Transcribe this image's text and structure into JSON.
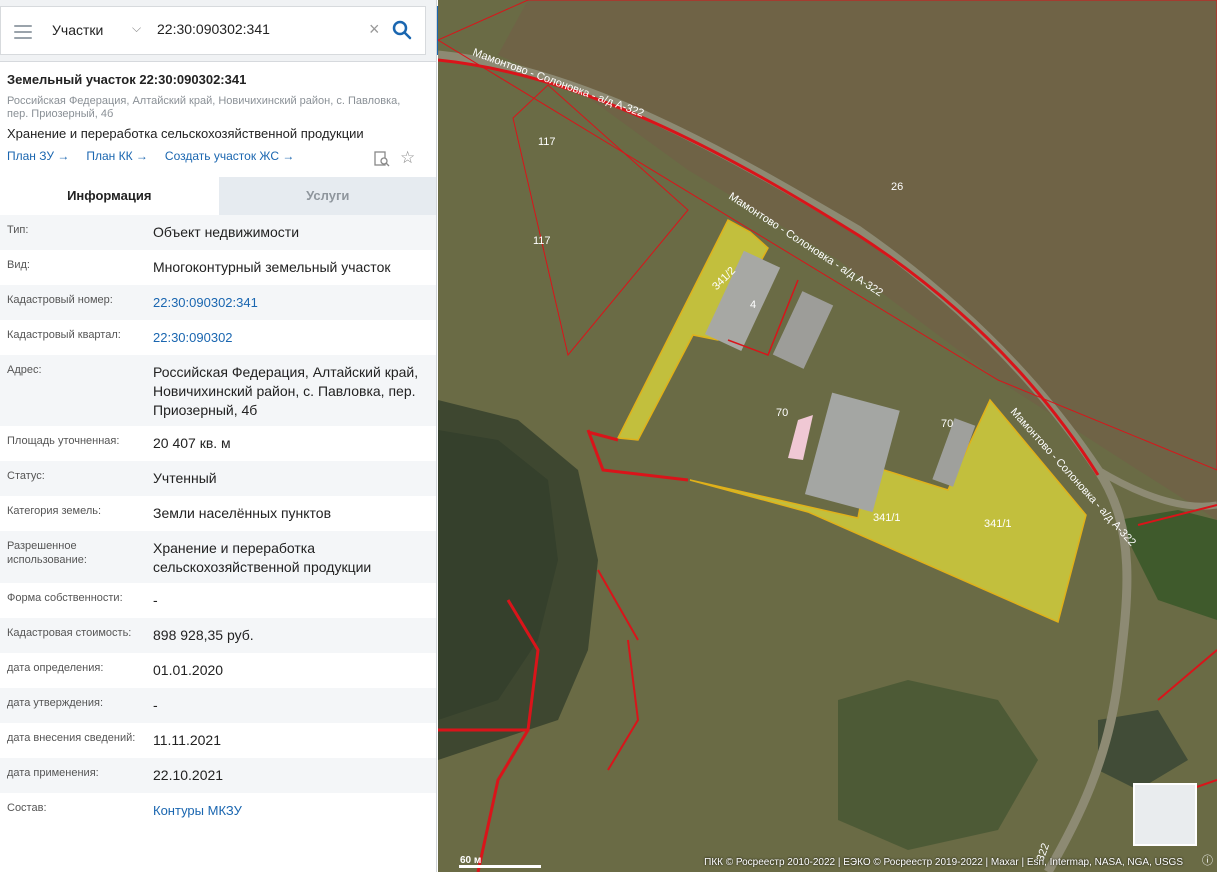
{
  "search": {
    "type_label": "Участки",
    "query": "22:30:090302:341"
  },
  "object": {
    "title": "Земельный участок 22:30:090302:341",
    "address_line1": "Российская Федерация, Алтайский край, Новичихинский район, с. Павловка,",
    "address_line2": "пер. Приозерный, 4б",
    "use": "Хранение и переработка сельскохозяйственной продукции",
    "links": [
      "План ЗУ →",
      "План КК →",
      "Создать участок ЖС →"
    ]
  },
  "tabs": [
    {
      "label": "Информация",
      "active": true
    },
    {
      "label": "Услуги",
      "active": false
    }
  ],
  "info": [
    {
      "key": "Тип:",
      "value": "Объект недвижимости"
    },
    {
      "key": "Вид:",
      "value": "Многоконтурный земельный участок"
    },
    {
      "key": "Кадастровый номер:",
      "value": "22:30:090302:341"
    },
    {
      "key": "Кадастровый квартал:",
      "value": "22:30:090302"
    },
    {
      "key": "Адрес:",
      "value": "Российская Федерация, Алтайский край, Новичихинский район, с. Павловка, пер. Приозерный, 4б"
    },
    {
      "key": "Площадь уточненная:",
      "value": "20 407 кв. м"
    },
    {
      "key": "Статус:",
      "value": "Учтенный"
    },
    {
      "key": "Категория земель:",
      "value": "Земли населённых пунктов"
    },
    {
      "key": "Разрешенное использование:",
      "value": "Хранение и переработка сельскохозяйственной продукции"
    },
    {
      "key": "Форма собственности:",
      "value": "-"
    },
    {
      "key": "Кадастровая стоимость:",
      "value": "898 928,35 руб."
    },
    {
      "key": "дата определения:",
      "value": "01.01.2020"
    },
    {
      "key": "дата утверждения:",
      "value": "-"
    },
    {
      "key": "дата внесения сведений:",
      "value": "11.11.2021"
    },
    {
      "key": "дата применения:",
      "value": "22.10.2021"
    },
    {
      "key": "Состав:",
      "value": "Контуры МКЗУ"
    }
  ],
  "map": {
    "road_label_1": "Мамонтово - Солоновка - а/д А-322",
    "road_label_2": "Мамонтово - Солоновка - а/д А-322",
    "road_label_3": "Мамонтово - Солоновка - а/д А-322",
    "parcel_labels": [
      "117",
      "117",
      "26",
      "341/2",
      "4",
      "70",
      "70",
      "341/1",
      "341/1",
      "322"
    ],
    "scale": "60 м",
    "attribution": "ПКК © Росреестр 2010-2022 | ЕЭКО © Росреестр 2019-2022 | Maxar | Esri, Intermap, NASA, NGA, USGS"
  },
  "colors": {
    "accent": "#1a66b0",
    "parcel_border": "#d9141a",
    "highlight_fill": "#e8e23a"
  }
}
